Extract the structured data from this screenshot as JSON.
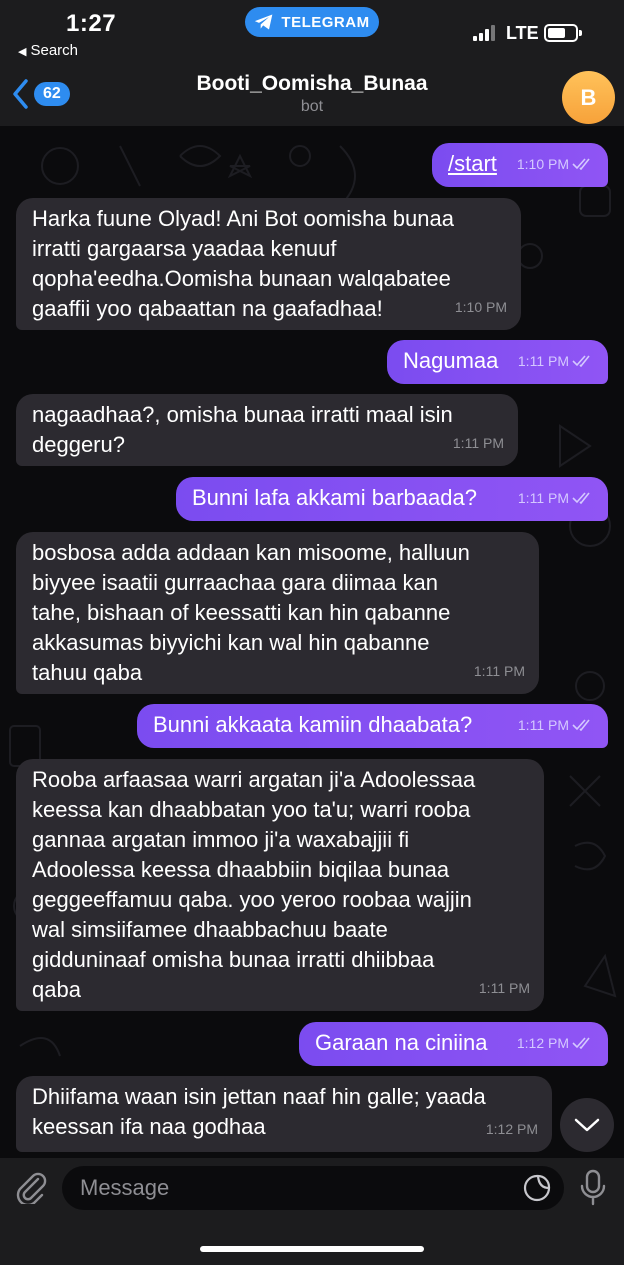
{
  "status_bar": {
    "time": "1:27",
    "back_label": "Search",
    "pill_label": "TELEGRAM",
    "network": "LTE"
  },
  "header": {
    "unread_count": "62",
    "title": "Booti_Oomisha_Bunaa",
    "subtitle": "bot",
    "avatar_letter": "B"
  },
  "messages": [
    {
      "dir": "out",
      "text": "/start",
      "time": "1:10 PM"
    },
    {
      "dir": "in",
      "text": "Harka fuune Olyad! Ani Bot oomisha bunaa\nirratti gargaarsa yaadaa kenuuf\nqopha'eedha.Oomisha bunaan walqabatee\ngaaffii yoo qabaattan na gaafadhaa!",
      "time": "1:10 PM"
    },
    {
      "dir": "out",
      "text": "Nagumaa",
      "time": "1:11 PM"
    },
    {
      "dir": "in",
      "text": "nagaadhaa?, omisha bunaa irratti maal isin\ndeggeru?",
      "time": "1:11 PM"
    },
    {
      "dir": "out",
      "text": "Bunni lafa akkami barbaada?",
      "time": "1:11 PM"
    },
    {
      "dir": "in",
      "text": "bosbosa adda addaan kan misoome, halluun\nbiyyee isaatii gurraachaa gara diimaa kan\ntahe, bishaan of keessatti kan hin qabanne\nakkasumas biyyichi kan wal hin qabanne\ntahuu qaba",
      "time": "1:11 PM"
    },
    {
      "dir": "out",
      "text": "Bunni akkaata kamiin dhaabata?",
      "time": "1:11 PM"
    },
    {
      "dir": "in",
      "text": "Rooba arfaasaa warri argatan ji'a Adoolessaa\nkeessa kan dhaabbatan yoo ta'u; warri rooba\ngannaa argatan immoo ji'a waxabajjii fi\nAdoolessa keessa dhaabbiin biqilaa bunaa\ngeggeeffamuu qaba. yoo yeroo roobaa wajjin\nwal simsiifamee dhaabbachuu baate\ngidduninaaf omisha bunaa irratti dhiibbaa\nqaba",
      "time": "1:11 PM"
    },
    {
      "dir": "out",
      "text": "Garaan na ciniina",
      "time": "1:12 PM"
    },
    {
      "dir": "in",
      "text": "Dhiifama waan isin jettan naaf hin galle; yaada\nkeessan ifa naa godhaa",
      "time": "1:12 PM"
    }
  ],
  "input": {
    "placeholder": "Message"
  },
  "icons": {
    "telegram": "telegram-logo-icon",
    "back": "chevron-left-icon",
    "attach": "paperclip-icon",
    "sticker": "sticker-icon",
    "mic": "microphone-icon",
    "scroll": "chevron-down-icon"
  },
  "colors": {
    "accent": "#2e8cf0",
    "outgoing_bubble": "#8550f2",
    "incoming_bubble": "#2c2a30",
    "avatar": "#f9b14a"
  }
}
